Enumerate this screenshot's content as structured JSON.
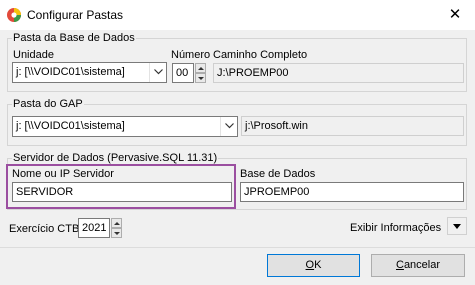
{
  "window": {
    "title": "Configurar Pastas",
    "close_symbol": "✕"
  },
  "pasta_base": {
    "legend": "Pasta da Base de Dados",
    "unidade_label": "Unidade",
    "unidade_value": "j: [\\\\VOIDC01\\sistema]",
    "numero_label": "Número",
    "numero_value": "00",
    "caminho_label": "Caminho Completo",
    "caminho_value": "J:\\PROEMP00"
  },
  "pasta_gap": {
    "legend": "Pasta do GAP",
    "unidade_value": "j: [\\\\VOIDC01\\sistema]",
    "path_value": "j:\\Prosoft.win"
  },
  "servidor": {
    "legend": "Servidor de Dados (Pervasive.SQL 11.31)",
    "nome_label": "Nome ou IP Servidor",
    "nome_value": "SERVIDOR",
    "base_label": "Base de Dados",
    "base_value": "JPROEMP00"
  },
  "exercicio": {
    "label": "Exercício CTB",
    "value": "2021"
  },
  "exibir": {
    "label": "Exibir Informações"
  },
  "buttons": {
    "ok": "OK",
    "cancel": "Cancelar"
  },
  "colors": {
    "highlight": "#9b4fa0",
    "accent": "#0078d7"
  }
}
